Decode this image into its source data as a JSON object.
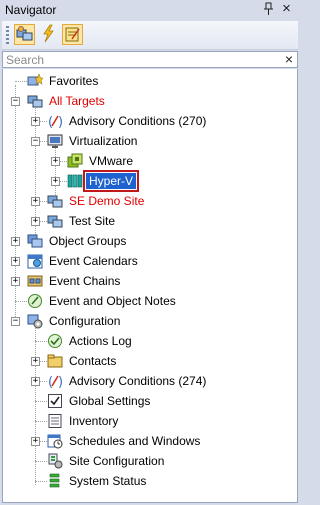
{
  "panel": {
    "title": "Navigator",
    "pin_glyph": "📌",
    "close_glyph": "×"
  },
  "toolbar": {
    "buttons": [
      "targets-icon",
      "lightning-icon",
      "notes-icon"
    ]
  },
  "search": {
    "placeholder": "Search",
    "value": "",
    "clear_glyph": "×"
  },
  "tree": {
    "favorites": "Favorites",
    "all_targets": "All Targets",
    "advisory_conditions": "Advisory Conditions (270)",
    "virtualization": "Virtualization",
    "vmware": "VMware",
    "hyper_v": "Hyper-V",
    "se_demo_site": "SE Demo Site",
    "test_site": "Test Site",
    "object_groups": "Object Groups",
    "event_calendars": "Event Calendars",
    "event_chains": "Event Chains",
    "event_notes": "Event and Object Notes",
    "configuration": "Configuration",
    "actions_log": "Actions Log",
    "contacts": "Contacts",
    "config_advisory": "Advisory Conditions (274)",
    "global_settings": "Global Settings",
    "inventory": "Inventory",
    "schedules": "Schedules and Windows",
    "site_configuration": "Site Configuration",
    "system_status": "System Status"
  },
  "colors": {
    "selected": "#1e62d0",
    "highlight_outline": "#c0181c",
    "alert_text": "#e00000"
  }
}
